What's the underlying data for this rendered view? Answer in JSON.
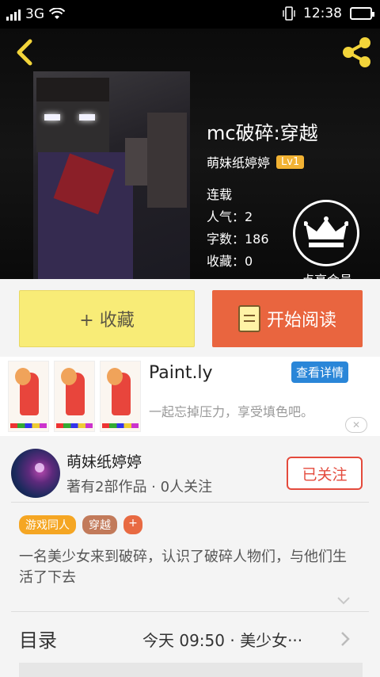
{
  "status_bar": {
    "network": "3G",
    "time": "12:38"
  },
  "book": {
    "title": "mc破碎:穿越",
    "author": "萌妹纸婷婷",
    "level": "Lv1",
    "status": "连载",
    "popularity": "人气：2",
    "word_count": "字数：186",
    "favorites": "收藏：0"
  },
  "vip": {
    "label": "点亮会员"
  },
  "actions": {
    "favorite_label": "+ 收藏",
    "read_label": "开始阅读"
  },
  "ad": {
    "app_name": "Paint.ly",
    "detail_label": "查看详情",
    "description": "一起忘掉压力，享受填色吧。"
  },
  "author_card": {
    "name": "萌妹纸婷婷",
    "stats": "著有2部作品 · 0人关注",
    "follow_label": "已关注"
  },
  "tags": [
    "游戏同人",
    "穿越"
  ],
  "tag_add": "+",
  "intro": "一名美少女来到破碎，认识了破碎人物们，与他们生活了下去",
  "toc": {
    "label": "目录",
    "latest": "今天 09:50 · 美少女···"
  },
  "colors": {
    "accent_orange": "#e9653f",
    "favorite_yellow": "#f8ec77",
    "follow_red": "#e44a3c",
    "level_badge": "#f2b233",
    "detail_blue": "#2a86d8"
  }
}
